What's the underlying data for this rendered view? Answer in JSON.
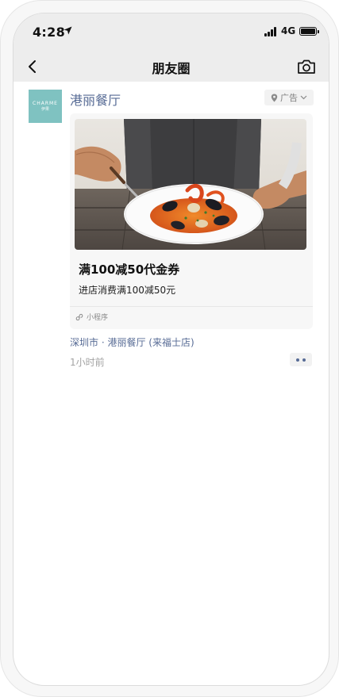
{
  "status_bar": {
    "time": "4:28",
    "network": "4G",
    "icons": [
      "location-arrow-icon",
      "signal-icon",
      "battery-icon"
    ]
  },
  "nav": {
    "title": "朋友圈",
    "icons": [
      "back-icon",
      "camera-icon"
    ]
  },
  "post": {
    "avatar": {
      "brand": "CHARME",
      "sub": "伊果",
      "color": "#7fc2c1"
    },
    "name": "港丽餐厅",
    "ad_label": "广告",
    "card": {
      "title": "满100减50代金券",
      "description": "进店消费满100减50元",
      "mini_program_label": "小程序"
    },
    "location": "深圳市 · 港丽餐厅 (来福士店)",
    "time": "1小时前"
  },
  "colors": {
    "link": "#576b95",
    "header_bg": "#ededed",
    "card_bg": "#f7f7f7"
  }
}
